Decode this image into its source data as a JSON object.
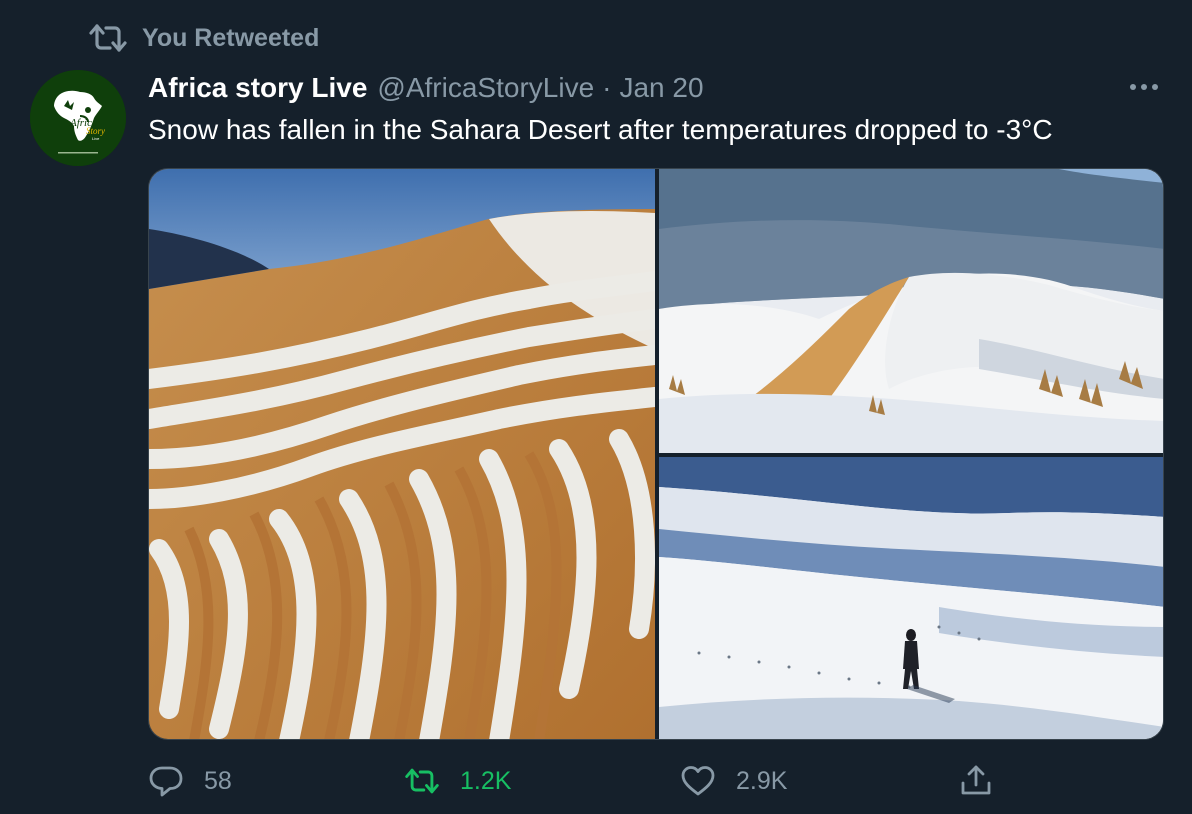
{
  "social_context": {
    "text": "You Retweeted",
    "icon": "retweet-icon"
  },
  "tweet": {
    "display_name": "Africa story Live",
    "handle": "@AfricaStoryLive",
    "separator": "·",
    "date": "Jan 20",
    "text": "Snow has fallen in the Sahara Desert after temperatures dropped to -3°C",
    "avatar_logo_text": "Africa Story Live",
    "media": [
      {
        "name": "snow-ripples-on-dune"
      },
      {
        "name": "snow-covered-dunes-with-mountain"
      },
      {
        "name": "person-walking-on-snowy-dunes"
      }
    ]
  },
  "actions": {
    "reply_count": "58",
    "retweet_count": "1.2K",
    "like_count": "2.9K"
  },
  "colors": {
    "background": "#15202b",
    "secondary_text": "#8899a6",
    "retweet_active": "#17bf63",
    "border": "#38444d"
  }
}
